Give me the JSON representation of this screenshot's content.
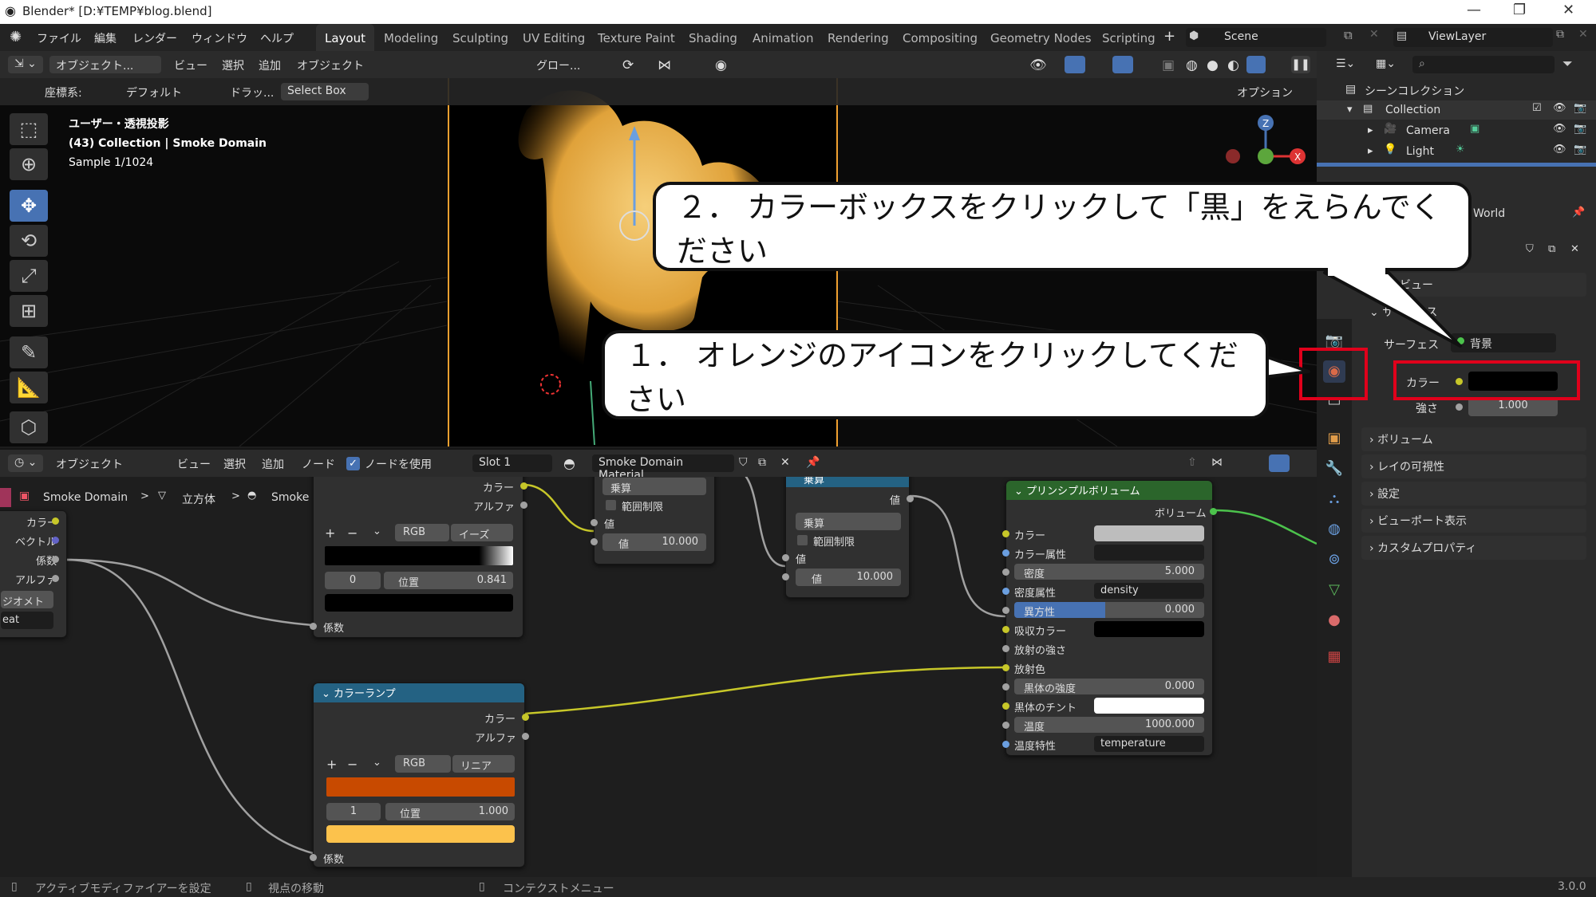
{
  "titlebar": {
    "title": "Blender* [D:¥TEMP¥blog.blend]",
    "min": "—",
    "max": "❐",
    "close": "✕"
  },
  "menus": [
    "ファイル",
    "編集",
    "レンダー",
    "ウィンドウ",
    "ヘルプ"
  ],
  "workspaces": [
    "Layout",
    "Modeling",
    "Sculpting",
    "UV Editing",
    "Texture Paint",
    "Shading",
    "Animation",
    "Rendering",
    "Compositing",
    "Geometry Nodes",
    "Scripting"
  ],
  "scene": "Scene",
  "viewlayer": "ViewLayer",
  "vp_header": {
    "mode": "オブジェクト...",
    "view": "ビュー",
    "select": "選択",
    "add": "追加",
    "object": "オブジェクト",
    "orient": "グロー...",
    "coords_label": "座標系:",
    "coords_value": "デフォルト",
    "drag": "ドラッ...",
    "select_box": "Select Box",
    "options": "オプション"
  },
  "viewport": {
    "line1": "ユーザー・透視投影",
    "line2": "(43) Collection | Smoke Domain",
    "line3": "Sample 1/1024"
  },
  "node_header": {
    "mode": "オブジェクト",
    "view": "ビュー",
    "select": "選択",
    "add": "追加",
    "node": "ノード",
    "use_nodes": "ノードを使用",
    "slot": "Slot 1",
    "material": "Smoke Domain Material"
  },
  "breadcrumb": {
    "obj": "Smoke Domain",
    "mesh": "立方体",
    "mat": "Smoke Domain Material"
  },
  "nodes": {
    "attr": {
      "out": [
        "カラー",
        "ベクトル",
        "係数",
        "アルファ"
      ],
      "type": "ジオメトリ",
      "name": "eat"
    },
    "ramp1": {
      "out": [
        "カラー",
        "アルファ"
      ],
      "mode": "RGB",
      "interp": "イーズ",
      "index": "0",
      "pos_label": "位置",
      "pos": "0.841",
      "in": "係数"
    },
    "math1": {
      "op": "乗算",
      "clamp": "範囲制限",
      "in_label": "値",
      "value_label": "値",
      "value": "10.000"
    },
    "math2": {
      "title": "乗算",
      "out": "値",
      "op": "乗算",
      "clamp": "範囲制限",
      "in_label": "値",
      "value_label": "値",
      "value": "10.000"
    },
    "ramp2": {
      "title": "カラーランプ",
      "out": [
        "カラー",
        "アルファ"
      ],
      "mode": "RGB",
      "interp": "リニア",
      "index": "1",
      "pos_label": "位置",
      "pos": "1.000",
      "in": "係数"
    },
    "principled": {
      "title": "プリンシプルボリューム",
      "out": "ボリューム",
      "color": "カラー",
      "color_attr": "カラー属性",
      "density_label": "密度",
      "density": "5.000",
      "density_attr_label": "密度属性",
      "density_attr": "density",
      "aniso_label": "異方性",
      "aniso": "0.000",
      "absorb": "吸収カラー",
      "emit_str": "放射の強さ",
      "emit_col": "放射色",
      "bb_label": "黒体の強度",
      "bb": "0.000",
      "bb_tint": "黒体のチント",
      "temp_label": "温度",
      "temp": "1000.000",
      "temp_attr_label": "温度特性",
      "temp_attr": "temperature"
    }
  },
  "outliner": {
    "scene_coll": "シーンコレクション",
    "collection": "Collection",
    "camera": "Camera",
    "light": "Light"
  },
  "props": {
    "world": "World",
    "preview": "プレビュー",
    "surface_panel": "サーフェス",
    "surface_label": "サーフェス",
    "surface_value": "背景",
    "color_label": "カラー",
    "strength_label": "強さ",
    "strength": "1.000",
    "volume": "ボリューム",
    "ray": "レイの可視性",
    "settings": "設定",
    "viewport_disp": "ビューポート表示",
    "custom": "カスタムプロパティ"
  },
  "status": {
    "a": "アクティブモディファイアーを設定",
    "b": "視点の移動",
    "c": "コンテクストメニュー",
    "version": "3.0.0"
  },
  "callouts": {
    "step1": "１．  オレンジのアイコンをクリックしてください",
    "step2": "２．  カラーボックスをクリックして「黒」をえらんでください"
  },
  "colors": {
    "accent": "#4772b3",
    "red": "#e0001b",
    "ramp_orange": "#c84a00",
    "ramp_yellow": "#fcc24c"
  }
}
